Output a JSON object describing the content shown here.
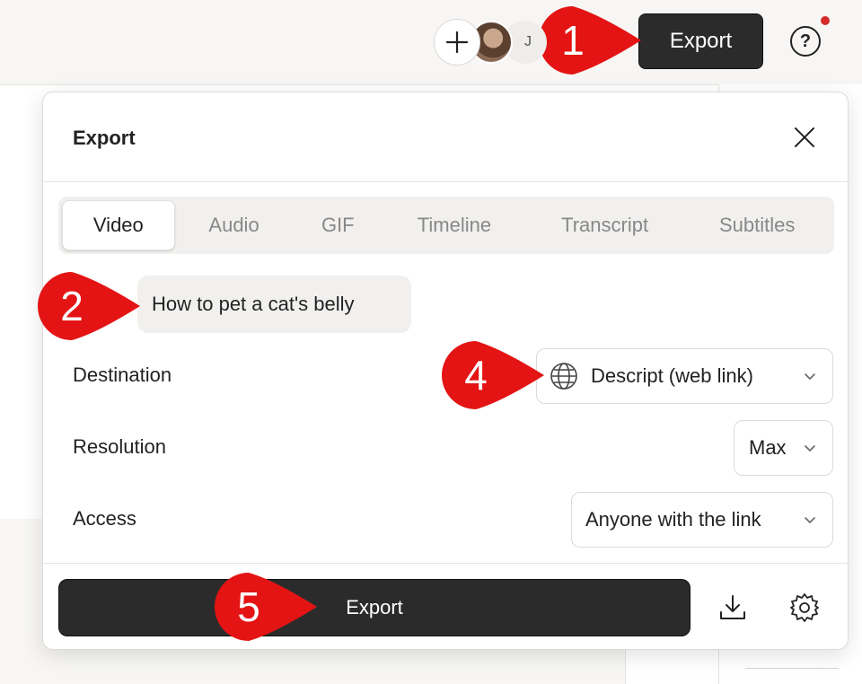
{
  "header": {
    "avatar_initial": "J",
    "export_label": "Export",
    "help_label": "?"
  },
  "dialog": {
    "title": "Export",
    "tabs": [
      {
        "label": "Video",
        "active": true
      },
      {
        "label": "Audio",
        "active": false
      },
      {
        "label": "GIF",
        "active": false
      },
      {
        "label": "Timeline",
        "active": false
      },
      {
        "label": "Transcript",
        "active": false
      },
      {
        "label": "Subtitles",
        "active": false
      }
    ],
    "project_title": "How to pet a cat's belly",
    "destination": {
      "label": "Destination",
      "value": "Descript (web link)"
    },
    "resolution": {
      "label": "Resolution",
      "value": "Max"
    },
    "access": {
      "label": "Access",
      "value": "Anyone with the link"
    },
    "export_button": "Export"
  },
  "callouts": [
    "1",
    "2",
    "4",
    "5"
  ],
  "colors": {
    "callout_red": "#e41414",
    "button_dark": "#2b2b2b",
    "notification_dot": "#d52b2b"
  },
  "icons": [
    "plus-icon",
    "close-icon",
    "globe-icon",
    "chevron-down-icon",
    "download-icon",
    "gear-icon",
    "help-icon"
  ]
}
